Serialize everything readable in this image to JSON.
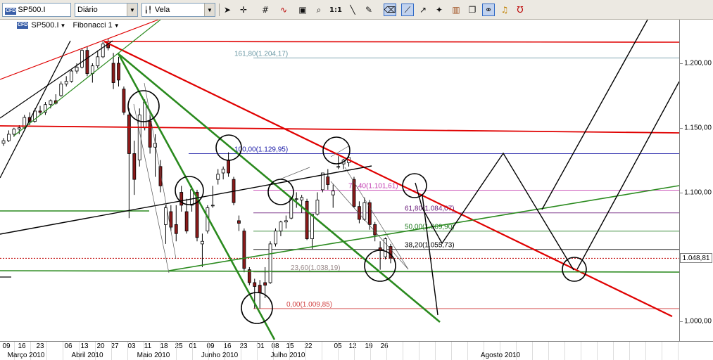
{
  "toolbar": {
    "symbol_value": "SP500.I",
    "period_value": "Diário",
    "chart_type_value": "Vela",
    "icons": [
      "cursor-icon",
      "crosshair-icon",
      "grid-icon",
      "wave-icon",
      "text-icon",
      "zoom-icon",
      "zoom-1to1-icon",
      "line-icon",
      "pen-icon",
      "eraser-icon",
      "arrow-icon",
      "marker-icon",
      "bars-icon",
      "chain-icon",
      "lock-icon",
      "bell-icon",
      "magnet-icon"
    ],
    "zoom_label": "1:1"
  },
  "legend": {
    "symbol": "SP500.I",
    "study": "Fibonacci 1"
  },
  "current_price": "1.048,81",
  "colors": {
    "red_line": "#e00000",
    "green_line": "#2a8a1e",
    "black_line": "#000000",
    "fib_161": "#6d9aa6",
    "fib_100": "#1d1da8",
    "fib_764": "#c23bb0",
    "fib_618": "#6a1b7a",
    "fib_500": "#1e7a1e",
    "fib_382": "#000000",
    "fib_236": "#9a8a8a",
    "fib_000": "#d04040"
  },
  "fib_levels": [
    {
      "label": "161,80(1.204,17)",
      "value": 1204.17,
      "color": "#6d9aa6"
    },
    {
      "label": "100,00(1.129,95)",
      "value": 1129.95,
      "color": "#1d1da8"
    },
    {
      "label": "76,40(1.101,61)",
      "value": 1101.61,
      "color": "#c23bb0"
    },
    {
      "label": "61,80(1.084,07)",
      "value": 1084.07,
      "color": "#6a1b7a"
    },
    {
      "label": "50,00(1.069,90)",
      "value": 1069.9,
      "color": "#1e7a1e"
    },
    {
      "label": "38,20(1.055,73)",
      "value": 1055.73,
      "color": "#000000"
    },
    {
      "label": "23,60(1.038,19)",
      "value": 1038.19,
      "color": "#9a8a8a"
    },
    {
      "label": "0,00(1.009,85)",
      "value": 1009.85,
      "color": "#d04040"
    }
  ],
  "y_axis": {
    "ticks": [
      "1.200,00",
      "1.150,00",
      "1.100,00",
      "1.050,00",
      "1.000,00"
    ],
    "tick_values": [
      1200,
      1150,
      1100,
      1050,
      1000
    ]
  },
  "x_axis": {
    "days": [
      "09",
      "16",
      "23",
      "06",
      "13",
      "20",
      "27",
      "03",
      "11",
      "18",
      "25",
      "01",
      "09",
      "16",
      "23",
      "01",
      "08",
      "15",
      "22",
      "05",
      "12",
      "19",
      "26"
    ],
    "months": [
      "Março 2010",
      "Abril 2010",
      "Maio 2010",
      "Junho 2010",
      "Julho 2010",
      "Agosto 2010"
    ]
  },
  "chart_data": {
    "type": "candlestick",
    "title": "",
    "xlabel": "",
    "ylabel": "",
    "ylim": [
      985,
      1230
    ],
    "candles": [
      {
        "date": "2010-03-08",
        "o": 1138,
        "h": 1142,
        "l": 1136,
        "c": 1140
      },
      {
        "date": "2010-03-10",
        "o": 1140,
        "h": 1148,
        "l": 1139,
        "c": 1145
      },
      {
        "date": "2010-03-12",
        "o": 1145,
        "h": 1150,
        "l": 1143,
        "c": 1149
      },
      {
        "date": "2010-03-15",
        "o": 1149,
        "h": 1152,
        "l": 1145,
        "c": 1150
      },
      {
        "date": "2010-03-17",
        "o": 1150,
        "h": 1160,
        "l": 1149,
        "c": 1158
      },
      {
        "date": "2010-03-19",
        "o": 1158,
        "h": 1162,
        "l": 1152,
        "c": 1155
      },
      {
        "date": "2010-03-22",
        "o": 1155,
        "h": 1165,
        "l": 1154,
        "c": 1163
      },
      {
        "date": "2010-03-24",
        "o": 1163,
        "h": 1167,
        "l": 1160,
        "c": 1162
      },
      {
        "date": "2010-03-26",
        "o": 1162,
        "h": 1170,
        "l": 1160,
        "c": 1168
      },
      {
        "date": "2010-03-29",
        "o": 1168,
        "h": 1172,
        "l": 1165,
        "c": 1171
      },
      {
        "date": "2010-03-31",
        "o": 1171,
        "h": 1176,
        "l": 1168,
        "c": 1169
      },
      {
        "date": "2010-04-05",
        "o": 1175,
        "h": 1186,
        "l": 1174,
        "c": 1184
      },
      {
        "date": "2010-04-07",
        "o": 1184,
        "h": 1190,
        "l": 1182,
        "c": 1186
      },
      {
        "date": "2010-04-09",
        "o": 1186,
        "h": 1195,
        "l": 1185,
        "c": 1194
      },
      {
        "date": "2010-04-12",
        "o": 1194,
        "h": 1200,
        "l": 1192,
        "c": 1197
      },
      {
        "date": "2010-04-14",
        "o": 1197,
        "h": 1212,
        "l": 1196,
        "c": 1210
      },
      {
        "date": "2010-04-16",
        "o": 1210,
        "h": 1213,
        "l": 1190,
        "c": 1192
      },
      {
        "date": "2010-04-19",
        "o": 1192,
        "h": 1200,
        "l": 1185,
        "c": 1198
      },
      {
        "date": "2010-04-21",
        "o": 1198,
        "h": 1210,
        "l": 1196,
        "c": 1205
      },
      {
        "date": "2010-04-23",
        "o": 1205,
        "h": 1217,
        "l": 1204,
        "c": 1215
      },
      {
        "date": "2010-04-26",
        "o": 1215,
        "h": 1219,
        "l": 1210,
        "c": 1212
      },
      {
        "date": "2010-04-28",
        "o": 1200,
        "h": 1208,
        "l": 1180,
        "c": 1185
      },
      {
        "date": "2010-04-30",
        "o": 1200,
        "h": 1205,
        "l": 1182,
        "c": 1187
      },
      {
        "date": "2010-05-04",
        "o": 1180,
        "h": 1182,
        "l": 1160,
        "c": 1162
      },
      {
        "date": "2010-05-06",
        "o": 1160,
        "h": 1165,
        "l": 1080,
        "c": 1130
      },
      {
        "date": "2010-05-07",
        "o": 1130,
        "h": 1140,
        "l": 1098,
        "c": 1110
      },
      {
        "date": "2010-05-10",
        "o": 1125,
        "h": 1165,
        "l": 1120,
        "c": 1160
      },
      {
        "date": "2010-05-12",
        "o": 1150,
        "h": 1172,
        "l": 1148,
        "c": 1170
      },
      {
        "date": "2010-05-14",
        "o": 1155,
        "h": 1160,
        "l": 1130,
        "c": 1135
      },
      {
        "date": "2010-05-17",
        "o": 1135,
        "h": 1145,
        "l": 1112,
        "c": 1138
      },
      {
        "date": "2010-05-19",
        "o": 1120,
        "h": 1125,
        "l": 1100,
        "c": 1105
      },
      {
        "date": "2010-05-21",
        "o": 1075,
        "h": 1090,
        "l": 1060,
        "c": 1088
      },
      {
        "date": "2010-05-24",
        "o": 1085,
        "h": 1090,
        "l": 1070,
        "c": 1073
      },
      {
        "date": "2010-05-26",
        "o": 1075,
        "h": 1090,
        "l": 1062,
        "c": 1068
      },
      {
        "date": "2010-05-28",
        "o": 1100,
        "h": 1105,
        "l": 1085,
        "c": 1090
      },
      {
        "date": "2010-06-01",
        "o": 1085,
        "h": 1095,
        "l": 1068,
        "c": 1070
      },
      {
        "date": "2010-06-03",
        "o": 1090,
        "h": 1105,
        "l": 1085,
        "c": 1102
      },
      {
        "date": "2010-06-04",
        "o": 1100,
        "h": 1102,
        "l": 1062,
        "c": 1065
      },
      {
        "date": "2010-06-08",
        "o": 1060,
        "h": 1068,
        "l": 1042,
        "c": 1062
      },
      {
        "date": "2010-06-10",
        "o": 1070,
        "h": 1090,
        "l": 1068,
        "c": 1088
      },
      {
        "date": "2010-06-14",
        "o": 1090,
        "h": 1105,
        "l": 1088,
        "c": 1090
      },
      {
        "date": "2010-06-16",
        "o": 1110,
        "h": 1118,
        "l": 1106,
        "c": 1114
      },
      {
        "date": "2010-06-18",
        "o": 1115,
        "h": 1120,
        "l": 1110,
        "c": 1118
      },
      {
        "date": "2010-06-21",
        "o": 1125,
        "h": 1131,
        "l": 1112,
        "c": 1115
      },
      {
        "date": "2010-06-23",
        "o": 1110,
        "h": 1112,
        "l": 1090,
        "c": 1092
      },
      {
        "date": "2010-06-25",
        "o": 1078,
        "h": 1082,
        "l": 1070,
        "c": 1076
      },
      {
        "date": "2010-06-29",
        "o": 1070,
        "h": 1072,
        "l": 1038,
        "c": 1041
      },
      {
        "date": "2010-06-30",
        "o": 1040,
        "h": 1042,
        "l": 1028,
        "c": 1030
      },
      {
        "date": "2010-07-01",
        "o": 1030,
        "h": 1033,
        "l": 1010,
        "c": 1027
      },
      {
        "date": "2010-07-02",
        "o": 1028,
        "h": 1032,
        "l": 1010,
        "c": 1022
      },
      {
        "date": "2010-07-06",
        "o": 1030,
        "h": 1042,
        "l": 1018,
        "c": 1028
      },
      {
        "date": "2010-07-07",
        "o": 1030,
        "h": 1062,
        "l": 1029,
        "c": 1060
      },
      {
        "date": "2010-07-08",
        "o": 1060,
        "h": 1072,
        "l": 1058,
        "c": 1070
      },
      {
        "date": "2010-07-09",
        "o": 1070,
        "h": 1078,
        "l": 1066,
        "c": 1077
      },
      {
        "date": "2010-07-12",
        "o": 1077,
        "h": 1082,
        "l": 1072,
        "c": 1078
      },
      {
        "date": "2010-07-13",
        "o": 1080,
        "h": 1096,
        "l": 1079,
        "c": 1095
      },
      {
        "date": "2010-07-14",
        "o": 1095,
        "h": 1100,
        "l": 1088,
        "c": 1095
      },
      {
        "date": "2010-07-15",
        "o": 1094,
        "h": 1098,
        "l": 1084,
        "c": 1096
      },
      {
        "date": "2010-07-16",
        "o": 1093,
        "h": 1095,
        "l": 1063,
        "c": 1064
      },
      {
        "date": "2010-07-20",
        "o": 1064,
        "h": 1083,
        "l": 1056,
        "c": 1083
      },
      {
        "date": "2010-07-22",
        "o": 1083,
        "h": 1100,
        "l": 1082,
        "c": 1094
      },
      {
        "date": "2010-07-26",
        "o": 1102,
        "h": 1115,
        "l": 1100,
        "c": 1115
      },
      {
        "date": "2010-07-28",
        "o": 1112,
        "h": 1118,
        "l": 1102,
        "c": 1106
      },
      {
        "date": "2010-07-30",
        "o": 1098,
        "h": 1106,
        "l": 1088,
        "c": 1101
      },
      {
        "date": "2010-08-03",
        "o": 1120,
        "h": 1128,
        "l": 1118,
        "c": 1120
      },
      {
        "date": "2010-08-05",
        "o": 1122,
        "h": 1126,
        "l": 1118,
        "c": 1125
      },
      {
        "date": "2010-08-09",
        "o": 1123,
        "h": 1130,
        "l": 1120,
        "c": 1127
      },
      {
        "date": "2010-08-11",
        "o": 1110,
        "h": 1112,
        "l": 1088,
        "c": 1089
      },
      {
        "date": "2010-08-13",
        "o": 1089,
        "h": 1093,
        "l": 1076,
        "c": 1079
      },
      {
        "date": "2010-08-17",
        "o": 1079,
        "h": 1096,
        "l": 1078,
        "c": 1092
      },
      {
        "date": "2010-08-19",
        "o": 1092,
        "h": 1094,
        "l": 1071,
        "c": 1075
      },
      {
        "date": "2010-08-23",
        "o": 1075,
        "h": 1077,
        "l": 1062,
        "c": 1067
      },
      {
        "date": "2010-08-25",
        "o": 1057,
        "h": 1062,
        "l": 1040,
        "c": 1055
      },
      {
        "date": "2010-08-27",
        "o": 1050,
        "h": 1065,
        "l": 1048,
        "c": 1064
      },
      {
        "date": "2010-08-31",
        "o": 1058,
        "h": 1060,
        "l": 1045,
        "c": 1049
      }
    ]
  }
}
